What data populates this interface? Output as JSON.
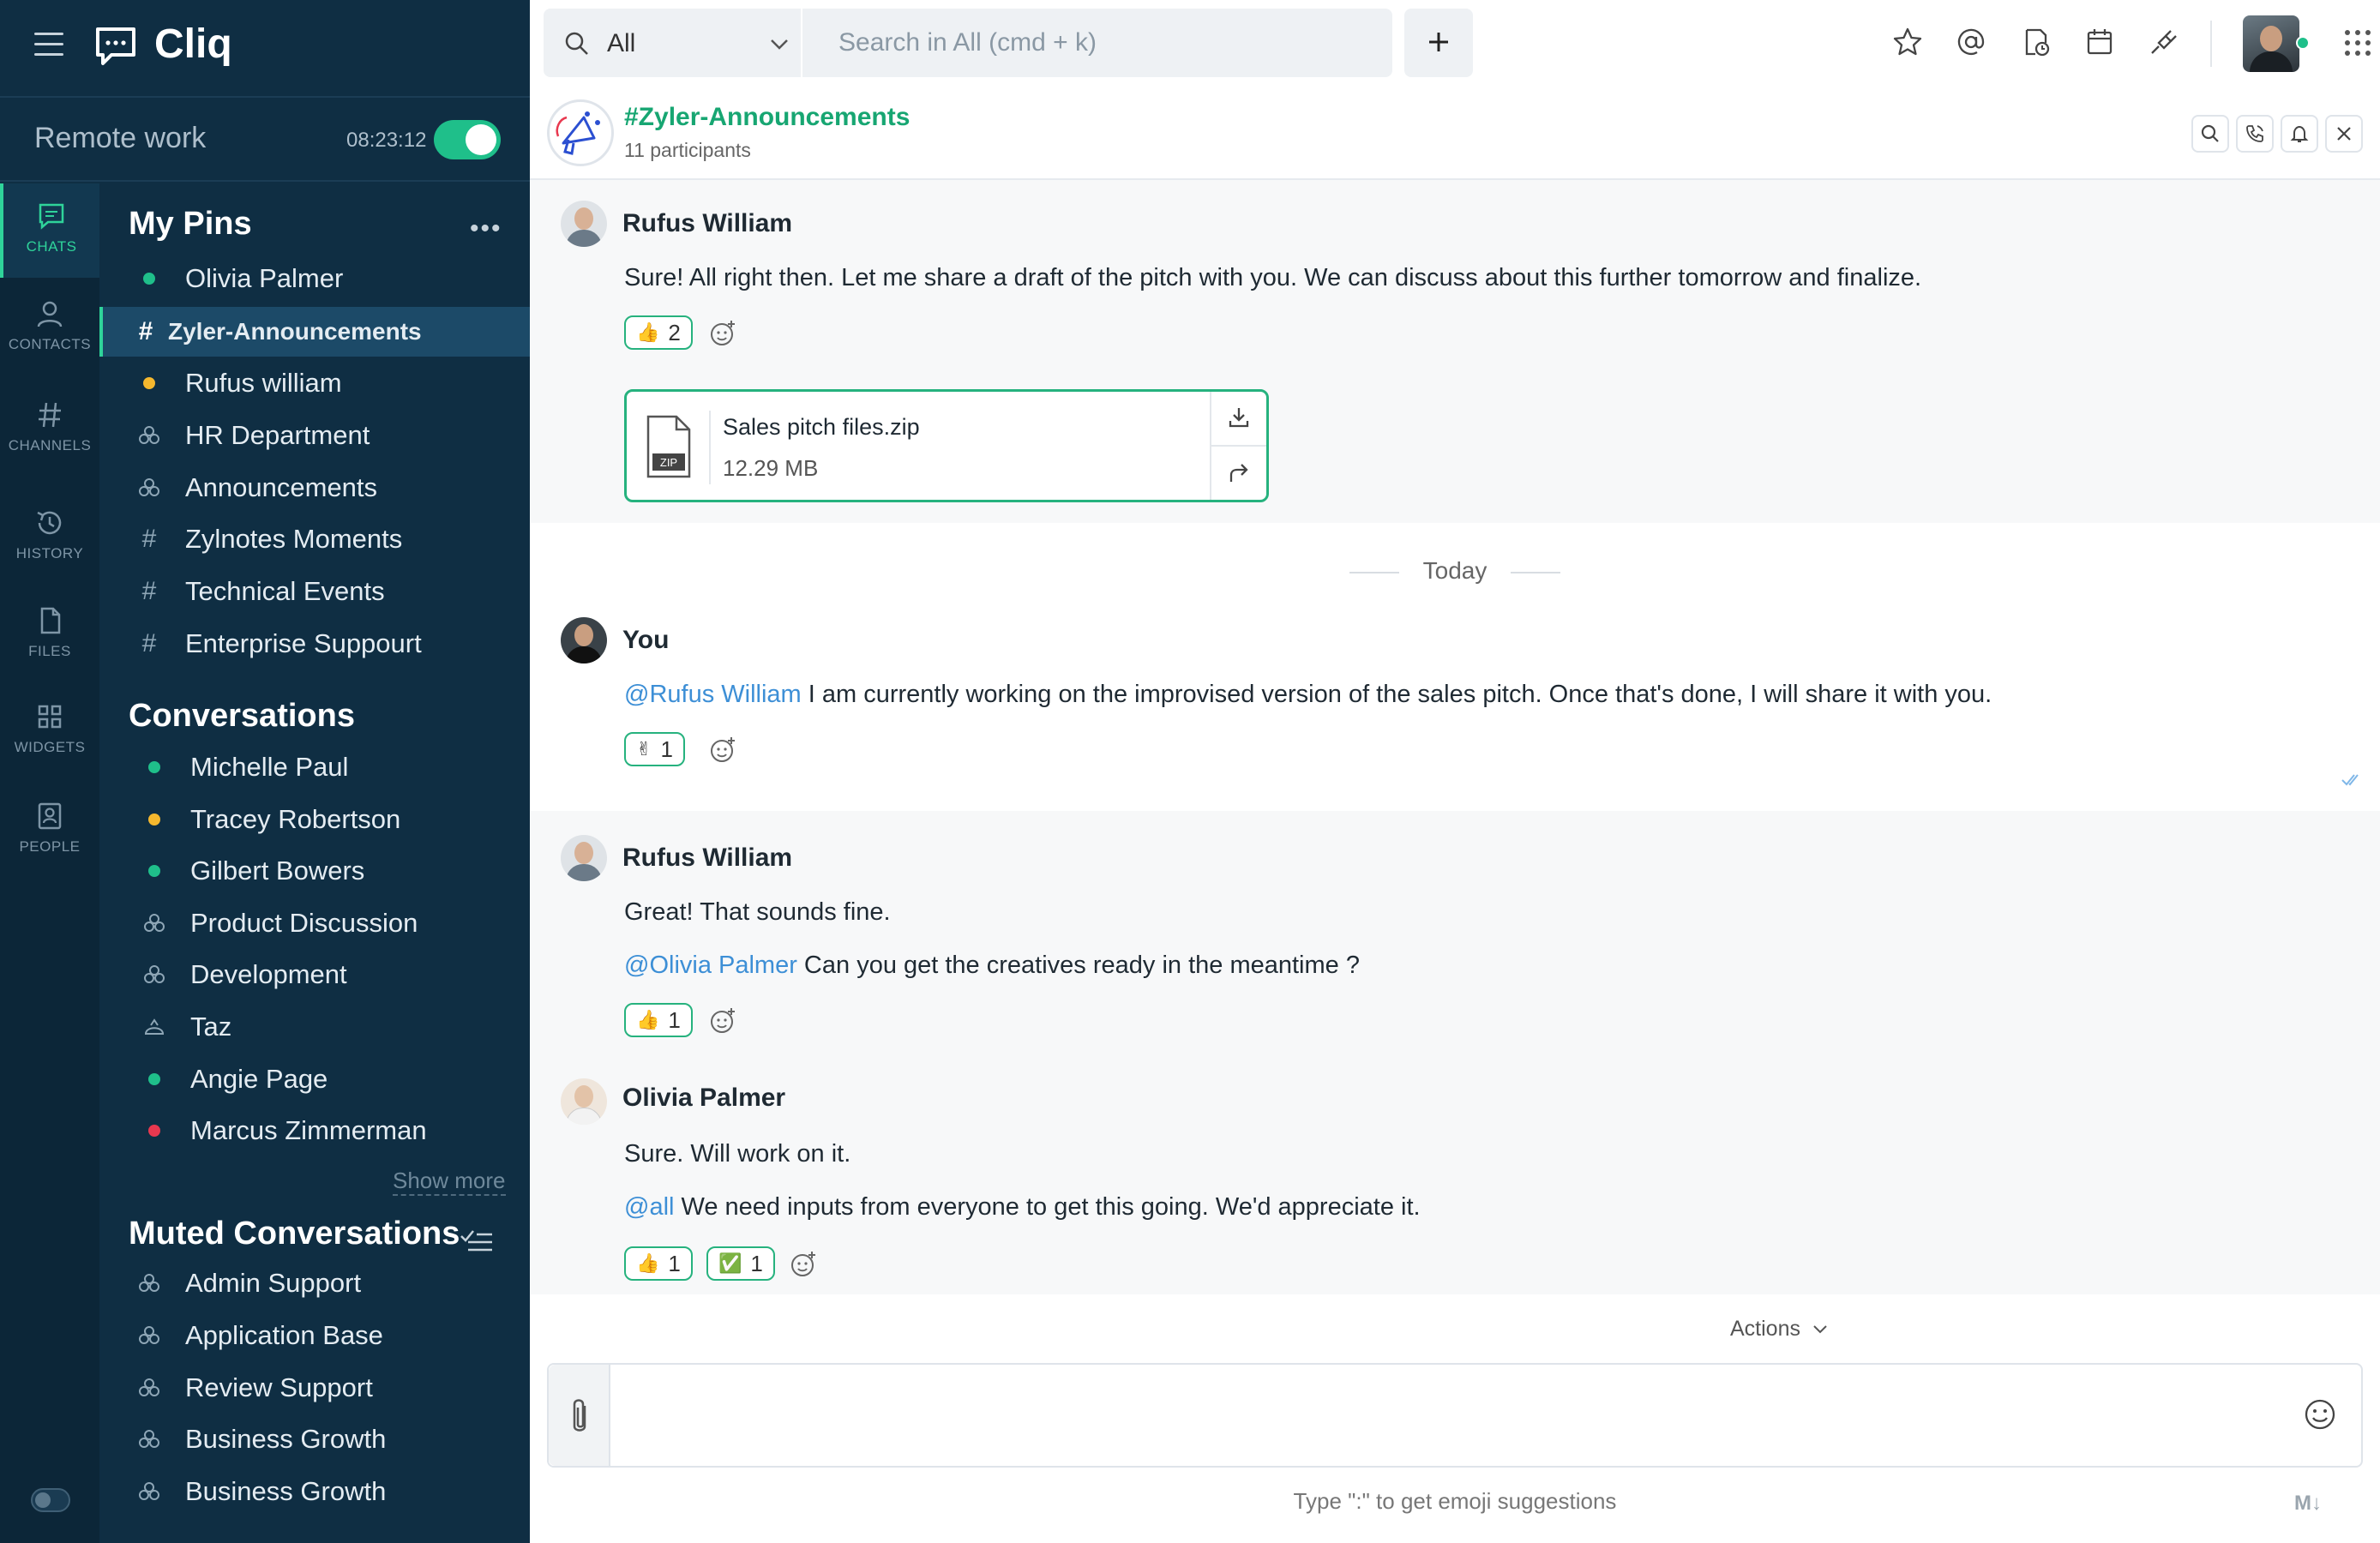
{
  "app": {
    "name": "Cliq"
  },
  "status": {
    "text": "Remote work",
    "timer": "08:23:12"
  },
  "nav_rail": [
    {
      "label": "CHATS",
      "icon": "chat-icon"
    },
    {
      "label": "CONTACTS",
      "icon": "person-icon"
    },
    {
      "label": "CHANNELS",
      "icon": "hash-icon"
    },
    {
      "label": "HISTORY",
      "icon": "history-icon"
    },
    {
      "label": "FILES",
      "icon": "file-icon"
    },
    {
      "label": "WIDGETS",
      "icon": "grid-icon"
    },
    {
      "label": "PEOPLE",
      "icon": "badge-icon"
    }
  ],
  "pins": {
    "title": "My Pins",
    "items": [
      {
        "label": "Olivia Palmer",
        "type": "dot",
        "color": "#1fbf8a"
      },
      {
        "label": "Zyler-Announcements",
        "type": "hash",
        "selected": true
      },
      {
        "label": "Rufus william",
        "type": "dot",
        "color": "#f5b82e"
      },
      {
        "label": "HR Department",
        "type": "group"
      },
      {
        "label": "Announcements",
        "type": "group"
      },
      {
        "label": "Zylnotes Moments",
        "type": "hash"
      },
      {
        "label": "Technical Events",
        "type": "hash"
      },
      {
        "label": "Enterprise Suppourt",
        "type": "hash"
      }
    ]
  },
  "conversations": {
    "title": "Conversations",
    "show_more": "Show more",
    "items": [
      {
        "label": "Michelle Paul",
        "type": "dot",
        "color": "#1fbf8a"
      },
      {
        "label": "Tracey Robertson",
        "type": "dot",
        "color": "#f5b82e"
      },
      {
        "label": "Gilbert Bowers",
        "type": "dot",
        "color": "#1fbf8a"
      },
      {
        "label": "Product Discussion",
        "type": "group"
      },
      {
        "label": "Development",
        "type": "group"
      },
      {
        "label": "Taz",
        "type": "bot"
      },
      {
        "label": "Angie Page",
        "type": "dot",
        "color": "#1fbf8a"
      },
      {
        "label": "Marcus Zimmerman",
        "type": "dot",
        "color": "#e8384f"
      }
    ]
  },
  "muted": {
    "title": "Muted Conversations",
    "items": [
      {
        "label": "Admin Support"
      },
      {
        "label": "Application Base"
      },
      {
        "label": "Review Support"
      },
      {
        "label": "Business Growth"
      },
      {
        "label": "Business Growth"
      }
    ]
  },
  "search": {
    "scope": "All",
    "placeholder": "Search in All (cmd + k)"
  },
  "channel": {
    "name": "#Zyler-Announcements",
    "participants": "11 participants"
  },
  "messages": {
    "m1": {
      "sender": "Rufus William",
      "text": "Sure! All right then. Let me share a draft of the pitch with you. We can discuss about this further tomorrow and finalize.",
      "reaction": {
        "emoji": "👍",
        "count": "2"
      }
    },
    "attachment": {
      "name": "Sales pitch files.zip",
      "size": "12.29 MB",
      "badge": "ZIP"
    },
    "day_separator": "Today",
    "m2": {
      "sender": "You",
      "mention": "@Rufus William",
      "text": " I am currently working on the improvised version of the sales pitch. Once that's done, I will share it with you.",
      "reaction": {
        "emoji": "✌",
        "count": "1"
      }
    },
    "m3": {
      "sender": "Rufus William",
      "text1": "Great! That sounds fine.",
      "mention": "@Olivia Palmer",
      "text2": " Can you get the creatives ready in the meantime ?",
      "reaction": {
        "emoji": "👍",
        "count": "1"
      }
    },
    "m4": {
      "sender": "Olivia Palmer",
      "text1": "Sure. Will work on it.",
      "mention": "@all",
      "text2": " We need inputs from everyone to get this going. We'd appreciate it.",
      "reactions": [
        {
          "emoji": "👍",
          "count": "1"
        },
        {
          "emoji": "✅",
          "count": "1"
        }
      ]
    }
  },
  "composer": {
    "actions": "Actions",
    "hint": "Type \":\" to get emoji suggestions",
    "markdown": "M↓"
  },
  "colors": {
    "accent": "#1fbf8a",
    "sidebar": "#0f2e43",
    "mention": "#3d8fd6",
    "channel_name": "#17a672"
  }
}
